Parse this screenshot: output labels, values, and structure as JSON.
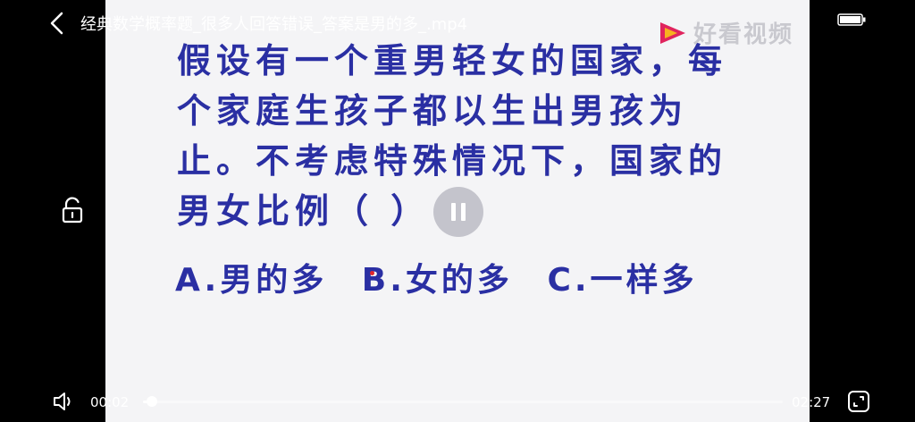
{
  "header": {
    "title": "经典数学概率题_很多人回答错误_答案是男的多_.mp4"
  },
  "watermark": {
    "text": "好看视频"
  },
  "video": {
    "question_lines": [
      "假设有一个重男轻女的国家，每",
      "个家庭生孩子都以生出男孩为",
      "止。不考虑特殊情况下，国家的",
      "男女比例（ ）"
    ],
    "options": [
      "A.男的多",
      "B.女的多",
      "C.一样多"
    ]
  },
  "player": {
    "time_current": "00:02",
    "time_total": "02:27",
    "progress_fraction": 0.014
  },
  "colors": {
    "question_text": "#2a2fa3",
    "frame_bg": "#f4f4f6",
    "accent_red": "#e1262c"
  }
}
